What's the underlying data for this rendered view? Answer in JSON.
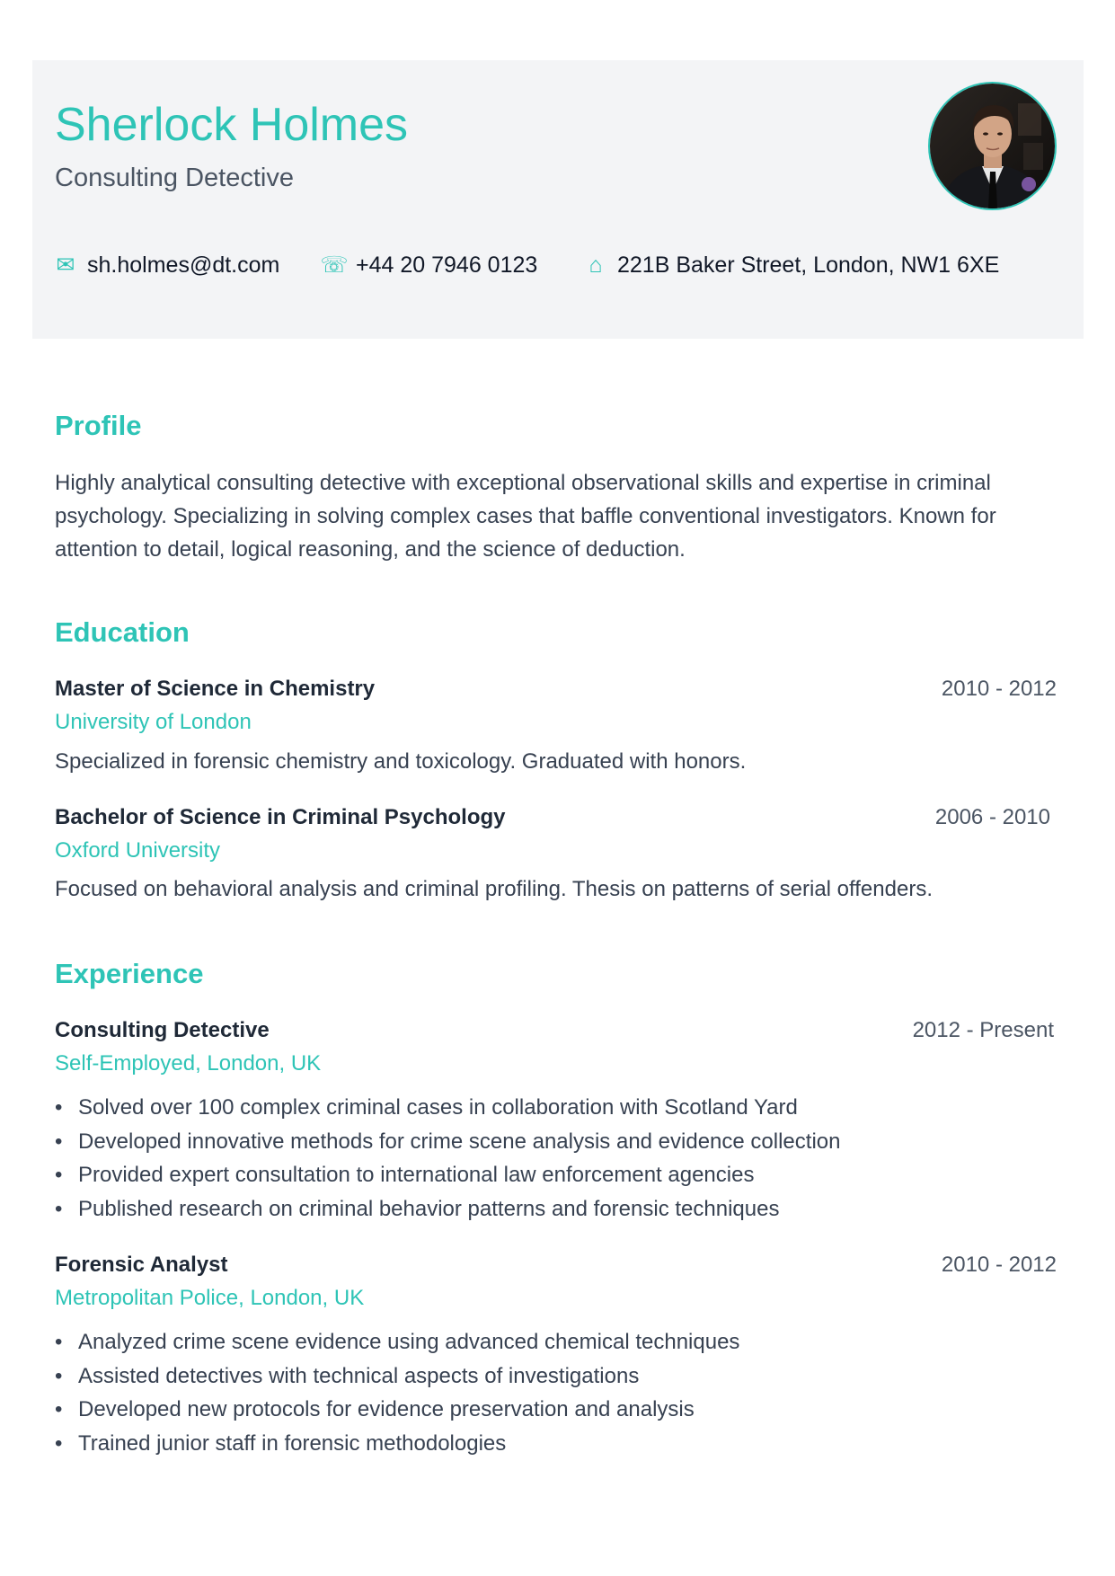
{
  "header": {
    "name": "Sherlock Holmes",
    "title": "Consulting Detective",
    "photo_alt": "profile-photo",
    "contacts": {
      "email": {
        "icon": "mail-icon",
        "glyph": "✉",
        "value": "sh.holmes@dt.com"
      },
      "phone": {
        "icon": "phone-icon",
        "glyph": "☏",
        "value": "+44 20 7946 0123"
      },
      "address": {
        "icon": "home-icon",
        "glyph": "⌂",
        "value": "221B Baker Street, London, NW1 6XE"
      }
    }
  },
  "profile": {
    "heading": "Profile",
    "text": "Highly analytical consulting detective with exceptional observational skills and expertise in criminal psychology. Specializing in solving complex cases that baffle conventional investigators. Known for attention to detail, logical reasoning, and the science of deduction."
  },
  "education": {
    "heading": "Education",
    "items": [
      {
        "degree": "Master of Science in Chemistry",
        "dates": "2010 - 2012",
        "school": "University of London",
        "description": "Specialized in forensic chemistry and toxicology. Graduated with honors."
      },
      {
        "degree": "Bachelor of Science in Criminal Psychology",
        "dates": "2006 - 2010",
        "school": "Oxford University",
        "description": "Focused on behavioral analysis and criminal profiling. Thesis on patterns of serial offenders."
      }
    ]
  },
  "experience": {
    "heading": "Experience",
    "bullet_char": "•",
    "items": [
      {
        "role": "Consulting Detective",
        "dates": "2012 - Present",
        "org": "Self-Employed, London, UK",
        "bullets": [
          "Solved over 100 complex criminal cases in collaboration with Scotland Yard",
          "Developed innovative methods for crime scene analysis and evidence collection",
          "Provided expert consultation to international law enforcement agencies",
          "Published research on criminal behavior patterns and forensic techniques"
        ]
      },
      {
        "role": "Forensic Analyst",
        "dates": "2010 - 2012",
        "org": "Metropolitan Police, London, UK",
        "bullets": [
          "Analyzed crime scene evidence using advanced chemical techniques",
          "Assisted detectives with technical aspects of investigations",
          "Developed new protocols for evidence preservation and analysis",
          "Trained junior staff in forensic methodologies"
        ]
      }
    ]
  },
  "colors": {
    "accent": "#2ec4b6",
    "header_bg": "#f3f4f6",
    "heading_text": "#1f2937",
    "body_text": "#374151"
  }
}
